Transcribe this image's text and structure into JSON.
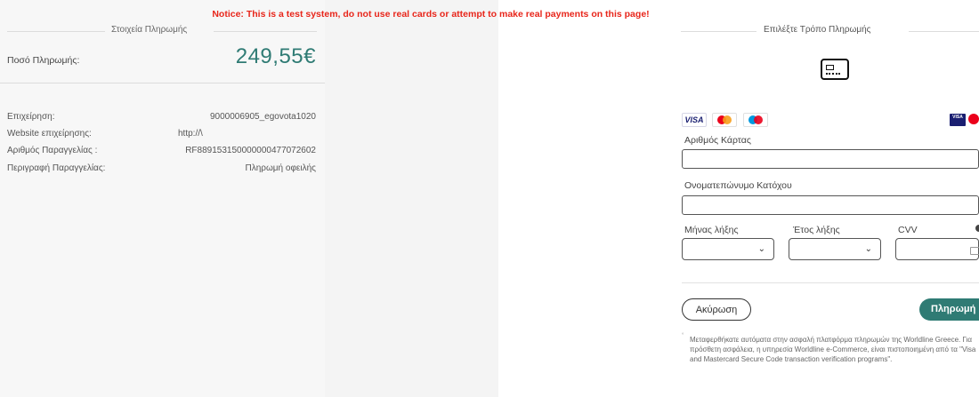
{
  "notice": "Notice: This is a test system, do not use real cards or attempt to make real payments on this page!",
  "payment_details": {
    "title": "Στοιχεία Πληρωμής",
    "amount_label": "Ποσό Πληρωμής:",
    "amount_value": "249,55€",
    "rows": [
      {
        "label": "Επιχείρηση:",
        "value": "9000006905_egovota1020"
      },
      {
        "label": "Website επιχείρησης:",
        "value": "http://\\"
      },
      {
        "label": "Αριθμός Παραγγελίας :",
        "value": "RF889153150000000477072602"
      },
      {
        "label": "Περιγραφή Παραγγελίας:",
        "value": "Πληρωμή οφειλής"
      }
    ]
  },
  "payment_method": {
    "title": "Επιλέξτε Τρόπο Πληρωμής",
    "method_icon": "credit-card-icon",
    "brands": [
      "VISA",
      "mastercard",
      "maestro"
    ],
    "card_number_label": "Αριθμός Κάρτας",
    "card_number_value": "",
    "holder_label": "Ονοματεπώνυμο Κατόχου",
    "holder_value": "",
    "month_label": "Μήνας λήξης",
    "month_value": "",
    "year_label": "Έτος λήξης",
    "year_value": "",
    "cvv_label": "CVV",
    "cvv_value": "",
    "cancel_label": "Ακύρωση",
    "pay_label": "Πληρωμή",
    "disclaimer": "Μεταφερθήκατε αυτόματα στην ασφαλή πλατφόρμα πληρωμών της Worldline Greece. Για πρόσθετη ασφάλεια, η υπηρεσία Worldline e-Commerce, είναι πιστοποιημένη από τα \"Visa and Mastercard Secure Code transaction verification programs\"."
  },
  "colors": {
    "accent": "#2f7b74",
    "notice": "#e8261b"
  }
}
